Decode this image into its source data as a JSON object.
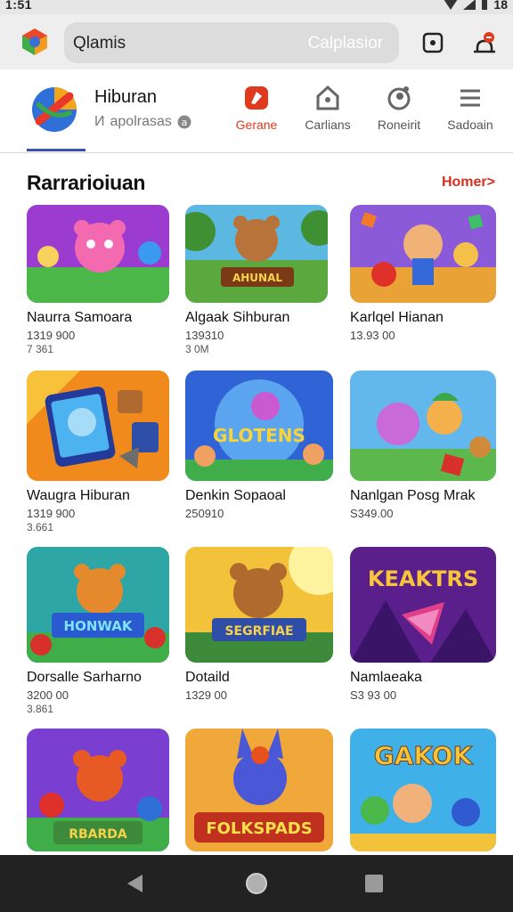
{
  "status_bar": {
    "time": "1:51",
    "right_text": "18"
  },
  "toolbar": {
    "search_value": "Qlamis",
    "search_placeholder": "Calplasior"
  },
  "header": {
    "title": "Hiburan",
    "subtitle_prefix": "И",
    "subtitle": "apolrasas",
    "nav": [
      {
        "label": "Gerane",
        "icon": "gamepad-icon",
        "active": true
      },
      {
        "label": "Carlians",
        "icon": "home-icon",
        "active": false
      },
      {
        "label": "Roneirit",
        "icon": "profile-icon",
        "active": false
      },
      {
        "label": "Sadoain",
        "icon": "menu-icon",
        "active": false
      }
    ]
  },
  "section": {
    "title": "Rarrarioiuan",
    "more_link": "Homer>"
  },
  "grid": [
    {
      "name": "Naurra Samoara",
      "price": "1319 900",
      "count": "7 361",
      "banner": ""
    },
    {
      "name": "Algaak Sihburan",
      "price": "139310",
      "count": "3 0M",
      "banner": "AHUNAL"
    },
    {
      "name": "Karlqel Hianan",
      "price": "13.93 00",
      "count": "",
      "banner": ""
    },
    {
      "name": "Waugra Hiburan",
      "price": "1319 900",
      "count": "3.661",
      "banner": ""
    },
    {
      "name": "Denkin Sopaoal",
      "price": "250910",
      "count": "",
      "banner": "GLOTENS"
    },
    {
      "name": "Nanlgan Posg Mrak",
      "price": "S349.00",
      "count": "",
      "banner": ""
    },
    {
      "name": "Dorsalle Sarharno",
      "price": "3200 00",
      "count": "3.861",
      "banner": "HONWAK"
    },
    {
      "name": "Dotaild",
      "price": "1329 00",
      "count": "",
      "banner": "SEGRFIAE"
    },
    {
      "name": "Namlaeaka",
      "price": "S3 93 00",
      "count": "",
      "banner": "KEAKTRS"
    },
    {
      "name": "",
      "price": "",
      "count": "",
      "banner": "RBARDA"
    },
    {
      "name": "",
      "price": "",
      "count": "",
      "banner": "FOLKSPADS"
    },
    {
      "name": "",
      "price": "",
      "count": "",
      "banner": "GAKOK"
    }
  ],
  "colors": {
    "accent": "#e03a1e",
    "link": "#d3301c",
    "underline": "#3b4fb8",
    "navbar": "#222222"
  }
}
